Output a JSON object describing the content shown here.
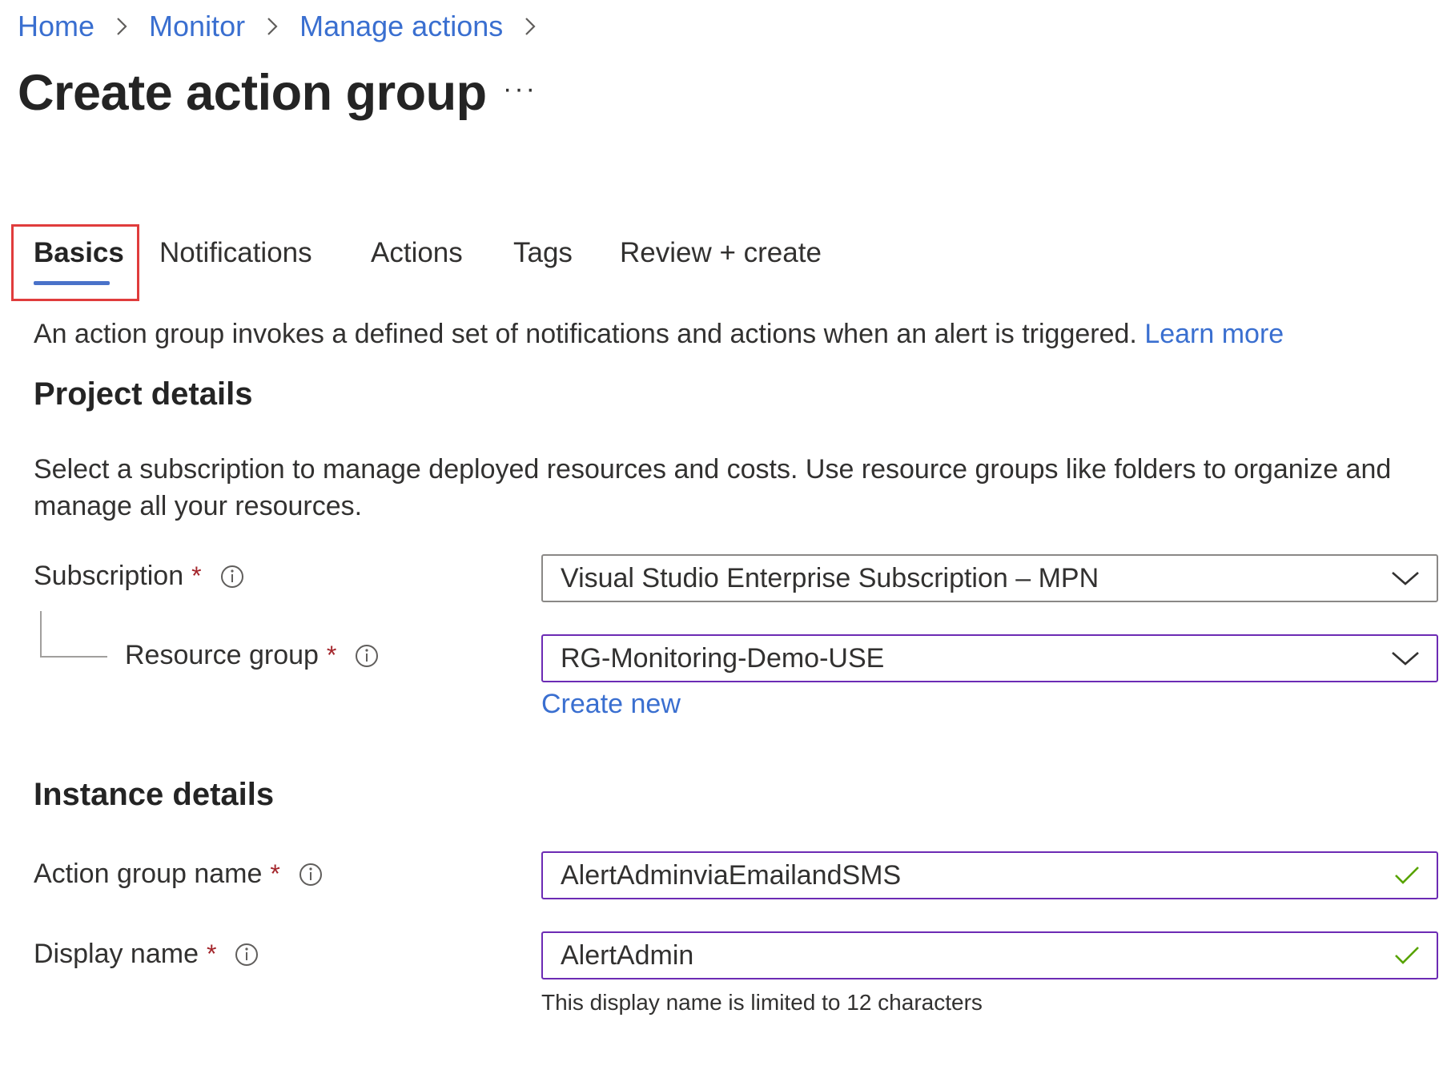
{
  "breadcrumb": {
    "items": [
      "Home",
      "Monitor",
      "Manage actions"
    ]
  },
  "header": {
    "title": "Create action group",
    "more_label": "···"
  },
  "tabs": [
    {
      "label": "Basics",
      "active": true
    },
    {
      "label": "Notifications",
      "active": false
    },
    {
      "label": "Actions",
      "active": false
    },
    {
      "label": "Tags",
      "active": false
    },
    {
      "label": "Review + create",
      "active": false
    }
  ],
  "intro": {
    "text": "An action group invokes a defined set of notifications and actions when an alert is triggered.",
    "link": "Learn more"
  },
  "project_details": {
    "heading": "Project details",
    "description": "Select a subscription to manage deployed resources and costs. Use resource groups like folders to organize and manage all your resources.",
    "subscription": {
      "label": "Subscription",
      "required_mark": "*",
      "value": "Visual Studio Enterprise Subscription – MPN"
    },
    "resource_group": {
      "label": "Resource group",
      "required_mark": "*",
      "value": "RG-Monitoring-Demo-USE",
      "create_new": "Create new"
    }
  },
  "instance_details": {
    "heading": "Instance details",
    "action_group_name": {
      "label": "Action group name",
      "required_mark": "*",
      "value": "AlertAdminviaEmailandSMS"
    },
    "display_name": {
      "label": "Display name",
      "required_mark": "*",
      "value": "AlertAdmin",
      "hint": "This display name is limited to 12 characters"
    }
  },
  "colors": {
    "link": "#3a6fd0",
    "required": "#a4262c",
    "focus_border": "#6c2bb4",
    "valid_check": "#57a300",
    "highlight": "#e03c3c",
    "tab_underline": "#4a72c9"
  }
}
